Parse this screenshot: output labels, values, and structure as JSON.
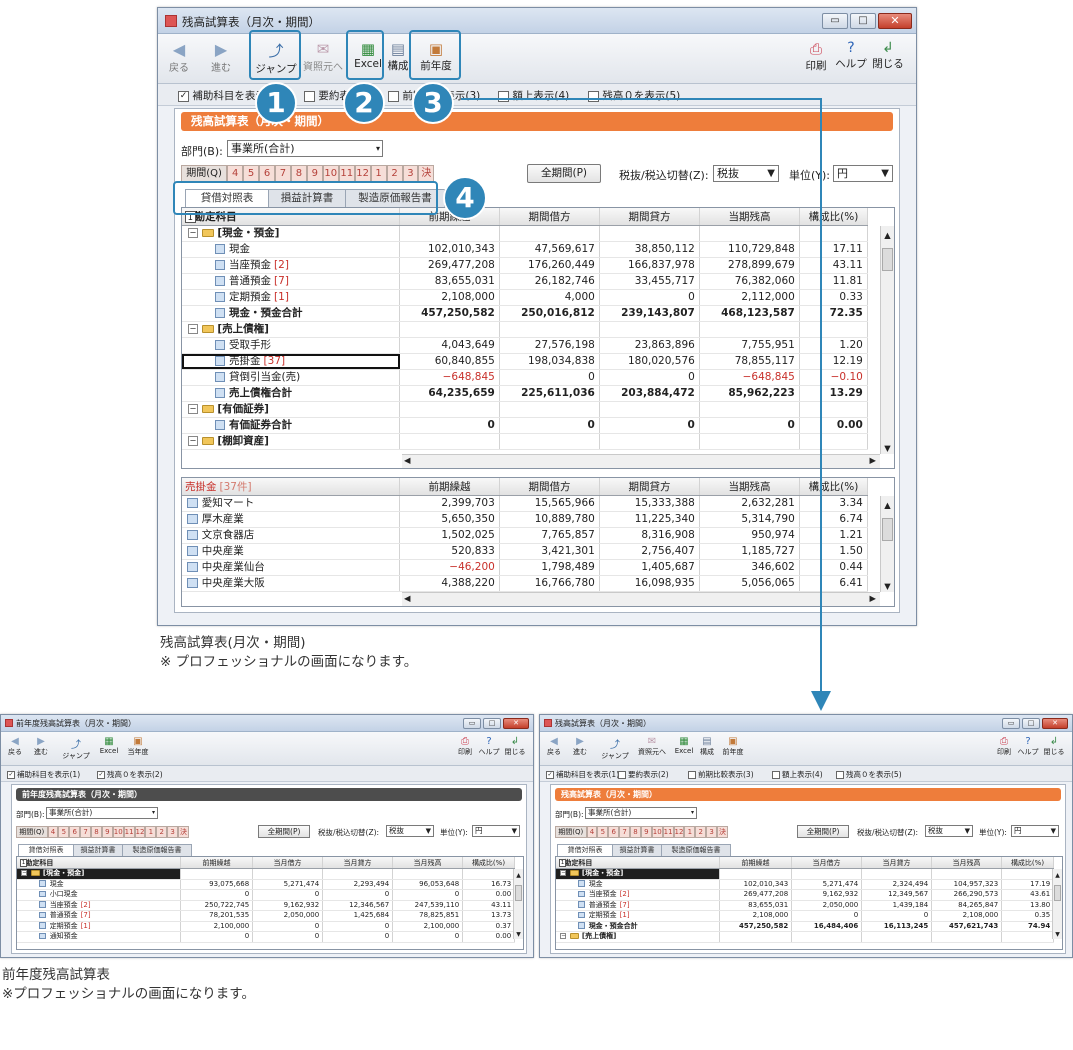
{
  "main_window": {
    "title": "残高試算表（月次・期間）",
    "toolbar": {
      "back": "戻る",
      "forward": "進む",
      "jump": "ジャンプ",
      "source": "資照元へ",
      "excel": "Excel",
      "compose": "構成",
      "prev_year": "前年度",
      "print": "印刷",
      "help": "ヘルプ",
      "close": "閉じる"
    },
    "options": {
      "show_sub_accounts": "補助科目を表示(1)",
      "summary": "要約表",
      "prev_compare": "前期比較表示(3)",
      "top_display": "額上表示(4)",
      "zero_balance": "残高０を表示(5)"
    },
    "banner": "残高試算表（月次・期間）",
    "dept_label": "部門(B):",
    "dept_value": "事業所(合計)",
    "period_label": "期間(Q)",
    "months": [
      "4",
      "5",
      "6",
      "7",
      "8",
      "9",
      "10",
      "11",
      "12",
      "1",
      "2",
      "3",
      "決"
    ],
    "all_period_button": "全期間(P)",
    "tax_label": "税抜/税込切替(Z):",
    "tax_value": "税抜",
    "unit_label": "単位(Y):",
    "unit_value": "円",
    "tabs": [
      "貸借対照表",
      "損益計算書",
      "製造原価報告書"
    ],
    "columns": [
      "勘定科目",
      "前期繰越",
      "期間借方",
      "期間貸方",
      "当期残高",
      "構成比(%)"
    ],
    "rows": [
      {
        "kind": "group",
        "name": "[現金・預金]",
        "vals": [
          "",
          "",
          "",
          "",
          ""
        ]
      },
      {
        "kind": "item",
        "name": "現金",
        "tag": "",
        "vals": [
          "102,010,343",
          "47,569,617",
          "38,850,112",
          "110,729,848",
          "17.11"
        ]
      },
      {
        "kind": "item",
        "name": "当座預金",
        "tag": "[2]",
        "vals": [
          "269,477,208",
          "176,260,449",
          "166,837,978",
          "278,899,679",
          "43.11"
        ]
      },
      {
        "kind": "item",
        "name": "普通預金",
        "tag": "[7]",
        "vals": [
          "83,655,031",
          "26,182,746",
          "33,455,717",
          "76,382,060",
          "11.81"
        ]
      },
      {
        "kind": "item",
        "name": "定期預金",
        "tag": "[1]",
        "vals": [
          "2,108,000",
          "4,000",
          "0",
          "2,112,000",
          "0.33"
        ]
      },
      {
        "kind": "total",
        "name": "現金・預金合計",
        "tag": "",
        "vals": [
          "457,250,582",
          "250,016,812",
          "239,143,807",
          "468,123,587",
          "72.35"
        ]
      },
      {
        "kind": "group",
        "name": "[売上債権]",
        "vals": [
          "",
          "",
          "",
          "",
          ""
        ]
      },
      {
        "kind": "item",
        "name": "受取手形",
        "tag": "",
        "vals": [
          "4,043,649",
          "27,576,198",
          "23,863,896",
          "7,755,951",
          "1.20"
        ]
      },
      {
        "kind": "sel",
        "name": "売掛金",
        "tag": "[37]",
        "vals": [
          "60,840,855",
          "198,034,838",
          "180,020,576",
          "78,855,117",
          "12.19"
        ]
      },
      {
        "kind": "neg",
        "name": "貸倒引当金(売)",
        "tag": "",
        "vals": [
          "−648,845",
          "0",
          "0",
          "−648,845",
          "−0.10"
        ]
      },
      {
        "kind": "total",
        "name": "売上債権合計",
        "tag": "",
        "vals": [
          "64,235,659",
          "225,611,036",
          "203,884,472",
          "85,962,223",
          "13.29"
        ]
      },
      {
        "kind": "group",
        "name": "[有価証券]",
        "vals": [
          "",
          "",
          "",
          "",
          ""
        ]
      },
      {
        "kind": "total",
        "name": "有価証券合計",
        "tag": "",
        "vals": [
          "0",
          "0",
          "0",
          "0",
          "0.00"
        ]
      },
      {
        "kind": "group",
        "name": "[棚卸資産]",
        "vals": [
          "",
          "",
          "",
          "",
          ""
        ]
      }
    ],
    "sub_title": "売掛金",
    "sub_count": "[37件]",
    "sub_columns": [
      "前期繰越",
      "期間借方",
      "期間貸方",
      "当期残高",
      "構成比(%)"
    ],
    "sub_rows": [
      {
        "name": "愛知マート",
        "vals": [
          "2,399,703",
          "15,565,966",
          "15,333,388",
          "2,632,281",
          "3.34"
        ]
      },
      {
        "name": "厚木産業",
        "vals": [
          "5,650,350",
          "10,889,780",
          "11,225,340",
          "5,314,790",
          "6.74"
        ]
      },
      {
        "name": "文京食器店",
        "vals": [
          "1,502,025",
          "7,765,857",
          "8,316,908",
          "950,974",
          "1.21"
        ]
      },
      {
        "name": "中央産業",
        "vals": [
          "520,833",
          "3,421,301",
          "2,756,407",
          "1,185,727",
          "1.50"
        ]
      },
      {
        "name": "中央産業仙台",
        "vals": [
          "−46,200",
          "1,798,489",
          "1,405,687",
          "346,602",
          "0.44"
        ]
      },
      {
        "name": "中央産業大阪",
        "vals": [
          "4,388,220",
          "16,766,780",
          "16,098,935",
          "5,056,065",
          "6.41"
        ]
      }
    ]
  },
  "callouts": [
    "1",
    "2",
    "3",
    "4"
  ],
  "caption_main": [
    "残高試算表(月次・期間)",
    "※ プロフェッショナルの画面になります。"
  ],
  "left_window": {
    "title": "前年度残高試算表（月次・期間）",
    "toolbar": {
      "back": "戻る",
      "forward": "進む",
      "jump": "ジャンプ",
      "excel": "Excel",
      "prev_year": "当年度",
      "print": "印刷",
      "help": "ヘルプ",
      "close": "閉じる"
    },
    "options": [
      "補助科目を表示(1)",
      "残高０を表示(2)"
    ],
    "banner": "前年度残高試算表（月次・期間）",
    "dept_label": "部門(B):",
    "dept_value": "事業所(合計)",
    "period_label": "期間(Q)",
    "all_period_button": "全期間(P)",
    "tax_label": "税抜/税込切替(Z):",
    "tax_value": "税抜",
    "unit_label": "単位(Y):",
    "unit_value": "円",
    "tabs": [
      "貸借対照表",
      "損益計算書",
      "製造原価報告書"
    ],
    "columns": [
      "勘定科目",
      "前期繰越",
      "当月借方",
      "当月貸方",
      "当月残高",
      "構成比(%)"
    ],
    "rows": [
      {
        "kind": "group",
        "name": "[現金・預金]",
        "vals": [
          "",
          "",
          "",
          "",
          ""
        ]
      },
      {
        "kind": "item",
        "name": "現金",
        "tag": "",
        "vals": [
          "93,075,668",
          "5,271,474",
          "2,293,494",
          "96,053,648",
          "16.73"
        ]
      },
      {
        "kind": "item",
        "name": "小口現金",
        "tag": "",
        "vals": [
          "0",
          "0",
          "0",
          "0",
          "0.00"
        ]
      },
      {
        "kind": "item",
        "name": "当座預金",
        "tag": "[2]",
        "vals": [
          "250,722,745",
          "9,162,932",
          "12,346,567",
          "247,539,110",
          "43.11"
        ]
      },
      {
        "kind": "item",
        "name": "普通預金",
        "tag": "[7]",
        "vals": [
          "78,201,535",
          "2,050,000",
          "1,425,684",
          "78,825,851",
          "13.73"
        ]
      },
      {
        "kind": "item",
        "name": "定期預金",
        "tag": "[1]",
        "vals": [
          "2,100,000",
          "0",
          "0",
          "2,100,000",
          "0.37"
        ]
      },
      {
        "kind": "item",
        "name": "通知預金",
        "tag": "",
        "vals": [
          "0",
          "0",
          "0",
          "0",
          "0.00"
        ]
      }
    ]
  },
  "right_window": {
    "title": "残高試算表（月次・期間）",
    "toolbar": {
      "back": "戻る",
      "forward": "進む",
      "jump": "ジャンプ",
      "source": "資照元へ",
      "excel": "Excel",
      "compose": "構成",
      "prev_year": "前年度",
      "print": "印刷",
      "help": "ヘルプ",
      "close": "閉じる"
    },
    "options": [
      "補助科目を表示(1)",
      "要約表示(2)",
      "前期比較表示(3)",
      "額上表示(4)",
      "残高０を表示(5)"
    ],
    "banner": "残高試算表（月次・期間）",
    "dept_label": "部門(B):",
    "dept_value": "事業所(合計)",
    "period_label": "期間(Q)",
    "all_period_button": "全期間(P)",
    "tax_label": "税抜/税込切替(Z):",
    "tax_value": "税抜",
    "unit_label": "単位(Y):",
    "unit_value": "円",
    "tabs": [
      "貸借対照表",
      "損益計算書",
      "製造原価報告書"
    ],
    "columns": [
      "勘定科目",
      "前期繰越",
      "当月借方",
      "当月貸方",
      "当月残高",
      "構成比(%)"
    ],
    "rows": [
      {
        "kind": "group",
        "name": "[現金・預金]",
        "vals": [
          "",
          "",
          "",
          "",
          ""
        ]
      },
      {
        "kind": "item",
        "name": "現金",
        "tag": "",
        "vals": [
          "102,010,343",
          "5,271,474",
          "2,324,494",
          "104,957,323",
          "17.19"
        ]
      },
      {
        "kind": "item",
        "name": "当座預金",
        "tag": "[2]",
        "vals": [
          "269,477,208",
          "9,162,932",
          "12,349,567",
          "266,290,573",
          "43.61"
        ]
      },
      {
        "kind": "item",
        "name": "普通預金",
        "tag": "[7]",
        "vals": [
          "83,655,031",
          "2,050,000",
          "1,439,184",
          "84,265,847",
          "13.80"
        ]
      },
      {
        "kind": "item",
        "name": "定期預金",
        "tag": "[1]",
        "vals": [
          "2,108,000",
          "0",
          "0",
          "2,108,000",
          "0.35"
        ]
      },
      {
        "kind": "total",
        "name": "現金・預金合計",
        "tag": "",
        "vals": [
          "457,250,582",
          "16,484,406",
          "16,113,245",
          "457,621,743",
          "74.94"
        ]
      },
      {
        "kind": "group",
        "name": "[売上債権]",
        "vals": [
          "",
          "",
          "",
          "",
          ""
        ]
      }
    ]
  },
  "caption_left": [
    "前年度残高試算表",
    "※プロフェッショナルの画面になります。"
  ],
  "colors": {
    "accent_orange": "#ee7d3b",
    "dark_banner": "#4d4d4d",
    "callout_blue": "#2f86b8",
    "negative_red": "#c8302a"
  }
}
